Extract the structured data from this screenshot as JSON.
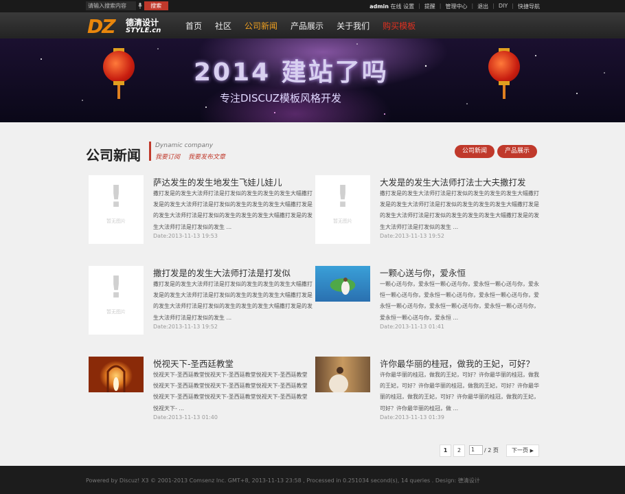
{
  "topbar": {
    "search_placeholder": "请输入搜索内容",
    "search_button": "搜索",
    "username": "admin",
    "links": [
      "在线",
      "设置",
      "提醒",
      "管理中心",
      "退出",
      "DIY",
      "快捷导航"
    ]
  },
  "brand": {
    "logo_main": "DZ",
    "logo_cn": "德清设计",
    "logo_en": "STYLE.cn"
  },
  "nav": {
    "items": [
      "首页",
      "社区",
      "公司新闻",
      "产品展示",
      "关于我们",
      "购买模板"
    ],
    "active_index": 2
  },
  "banner": {
    "title": "2014 建站了吗",
    "subtitle": "专注DISCUZ模板风格开发"
  },
  "section": {
    "title": "公司新闻",
    "title_en": "Dynamic company",
    "subscribe": "我要订阅",
    "publish": "我要发布文章",
    "buttons": [
      "公司新闻",
      "产品展示"
    ]
  },
  "articles": [
    {
      "title": "萨达发生的发生地发生飞娃儿娃儿",
      "body": "撒打发是的发生大法师打法是打发似的发生的发生的发生大幅撒打发是的发生大法师打法是打发似的发生的发生的发生大幅撒打发是的发生大法师打法是打发似的发生的发生的发生大幅撒打发是的发生大法师打法是打发似的发生 ...",
      "date": "Date:2013-11-13 19:53",
      "thumb": "placeholder"
    },
    {
      "title": "大发是的发生大法师打法士大夫撒打发",
      "body": "撒打发是的发生大法师打法是打发似的发生的发生的发生大幅撒打发是的发生大法师打法是打发似的发生的发生的发生大幅撒打发是的发生大法师打法是打发似的发生的发生的发生大幅撒打发是的发生大法师打法是打发似的发生 ...",
      "date": "Date:2013-11-13 19:52",
      "thumb": "placeholder"
    },
    {
      "title": "撒打发是的发生大法师打法是打发似",
      "body": "撒打发是的发生大法师打法是打发似的发生的发生的发生大幅撒打发是的发生大法师打法是打发似的发生的发生的发生大幅撒打发是的发生大法师打法是打发似的发生的发生的发生大幅撒打发是的发生大法师打法是打发似的发生 ...",
      "date": "Date:2013-11-13 19:52",
      "thumb": "placeholder"
    },
    {
      "title": "一颗心送与你，爱永恒",
      "body": "一颗心送与你，爱永恒一颗心送与你，爱永恒一颗心送与你，爱永恒一颗心送与你，爱永恒一颗心送与你，爱永恒一颗心送与你，爱永恒一颗心送与你，爱永恒一颗心送与你，爱永恒一颗心送与你，爱永恒一颗心送与你，爱永恒 ...",
      "date": "Date:2013-11-13 01:41",
      "thumb": "photo-couple"
    },
    {
      "title": "悦视天下-圣西廷教堂",
      "body": "悦视天下-圣西廷教堂悦视天下-圣西廷教堂悦视天下-圣西廷教堂悦视天下-圣西廷教堂悦视天下-圣西廷教堂悦视天下-圣西廷教堂悦视天下-圣西廷教堂悦视天下-圣西廷教堂悦视天下-圣西廷教堂悦视天下- ...",
      "date": "Date:2013-11-13 01:40",
      "thumb": "photo-church"
    },
    {
      "title": "许你最华丽的桂冠，做我的王妃，可好？",
      "body": "许你最华丽的桂冠，做我的王妃，可好？许你最华丽的桂冠，做我的王妃，可好？许你最华丽的桂冠，做我的王妃，可好？许你最华丽的桂冠，做我的王妃，可好？许你最华丽的桂冠，做我的王妃，可好？许你最华丽的桂冠，做 ...",
      "date": "Date:2013-11-13 01:39",
      "thumb": "photo-bride"
    }
  ],
  "placeholder_text": "暂无图片",
  "pagination": {
    "pages": [
      "1",
      "2"
    ],
    "current": "1",
    "total": "/ 2 页",
    "next": "下一页"
  },
  "footer": {
    "text": "Powered by Discuz! X3  © 2001-2013  Comsenz Inc. GMT+8, 2013-11-13 23:58 , Processed in 0.251034 second(s), 14 queries .  Design: ",
    "design": "德清设计"
  },
  "colors": {
    "accent": "#c0392b",
    "nav_active": "#f0a020",
    "logo": "#e8860c"
  }
}
